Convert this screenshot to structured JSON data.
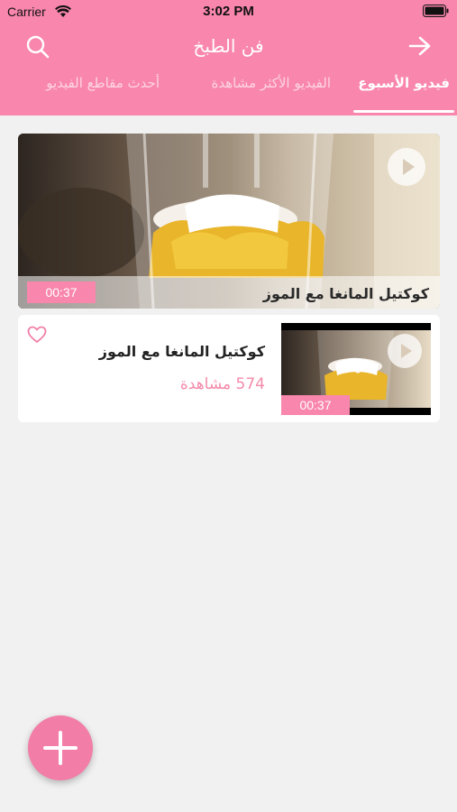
{
  "status": {
    "carrier": "Carrier",
    "time": "3:02 PM"
  },
  "nav": {
    "title": "فن الطبخ"
  },
  "tabs": [
    {
      "label": "فيديو الأسبوع",
      "active": true
    },
    {
      "label": "الفيديو الأكثر مشاهدة",
      "active": false
    },
    {
      "label": "أحدث مقاطع الفيديو",
      "active": false
    }
  ],
  "featured": {
    "title": "كوكتيل المانغا مع الموز",
    "duration": "00:37"
  },
  "videos": [
    {
      "title": "كوكتيل المانغا مع الموز",
      "views": "574 مشاهدة",
      "duration": "00:37"
    }
  ],
  "colors": {
    "accent": "#f986ac",
    "views_text": "#f48aab",
    "background": "#f1f1f1"
  },
  "icons": {
    "search": "search-icon",
    "forward": "arrow-right-icon",
    "play": "play-icon",
    "favorite": "heart-outline-icon",
    "add": "plus-icon"
  }
}
